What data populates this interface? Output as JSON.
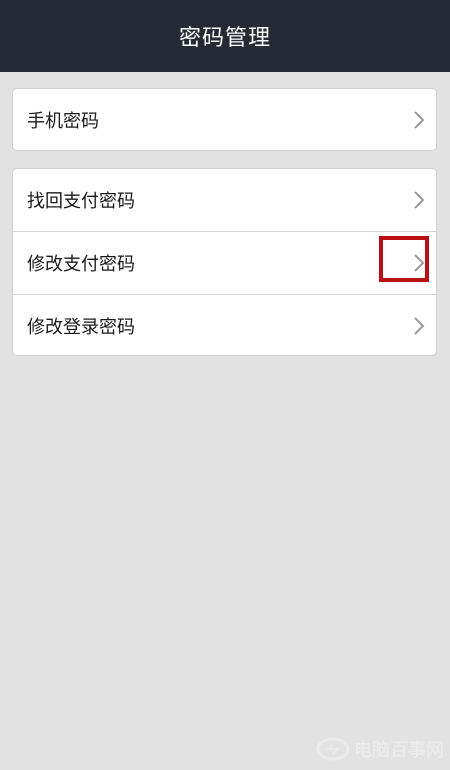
{
  "header": {
    "title": "密码管理"
  },
  "groups": [
    {
      "items": [
        {
          "label": "手机密码"
        }
      ]
    },
    {
      "items": [
        {
          "label": "找回支付密码"
        },
        {
          "label": "修改支付密码"
        },
        {
          "label": "修改登录密码"
        }
      ]
    }
  ],
  "icons": {
    "row_arrow": "chevron-right-icon"
  },
  "colors": {
    "header_bg": "#262a35",
    "page_bg": "#e2e2e2",
    "highlight": "#b81014"
  },
  "watermark": {
    "text": "电脑百事网"
  }
}
